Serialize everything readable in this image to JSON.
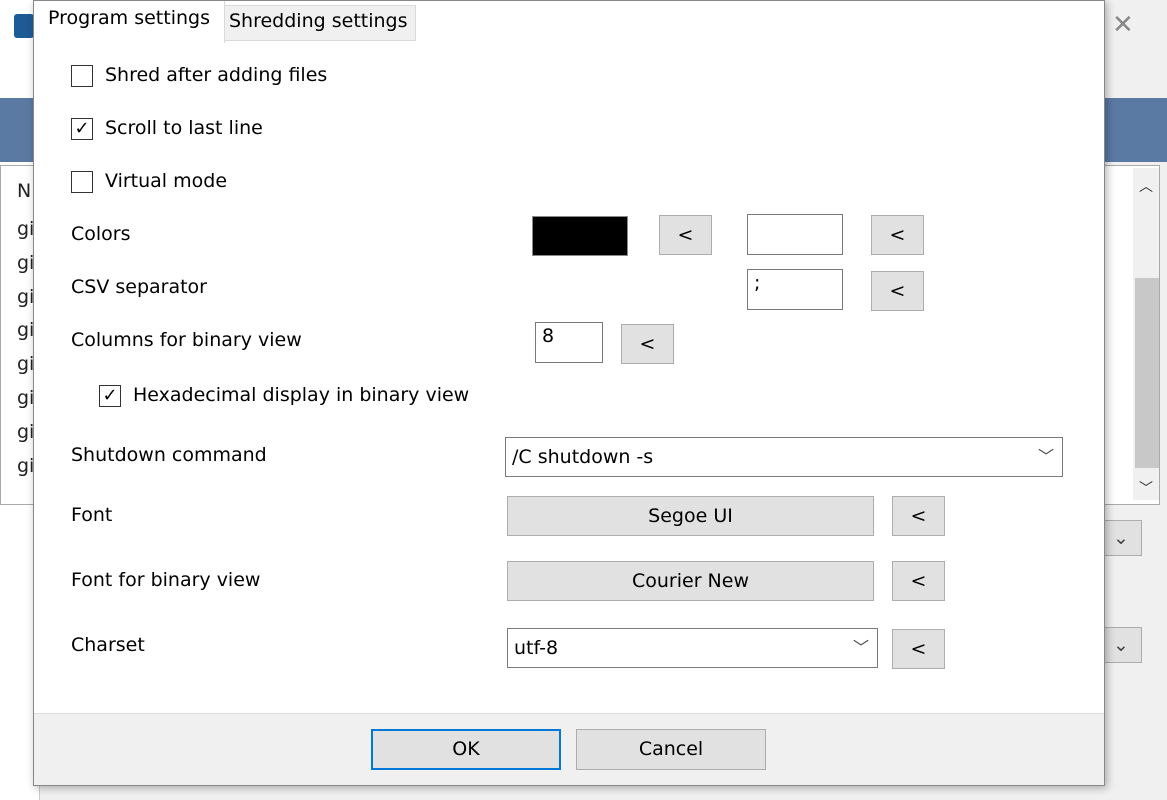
{
  "background_window": {
    "list_header": "N",
    "rows": [
      "gi",
      "gi",
      "gi",
      "gi",
      "gi",
      "gi",
      "gi",
      "gi"
    ],
    "close_icon": "close-icon"
  },
  "tabs": [
    {
      "label": "Program settings",
      "active": true
    },
    {
      "label": "Shredding settings",
      "active": false
    }
  ],
  "options": {
    "shred_after_adding": {
      "label": "Shred after adding files",
      "checked": false
    },
    "scroll_last_line": {
      "label": "Scroll to last line",
      "checked": true
    },
    "virtual_mode": {
      "label": "Virtual mode",
      "checked": false
    },
    "hex_display": {
      "label": "Hexadecimal display in binary view",
      "checked": true
    }
  },
  "colors": {
    "label": "Colors",
    "foreground": "#000000",
    "background": "#ffffff",
    "reset": "<"
  },
  "csv": {
    "label": "CSV separator",
    "value": ";",
    "reset": "<"
  },
  "binary_columns": {
    "label": "Columns for binary view",
    "value": "8",
    "reset": "<"
  },
  "shutdown": {
    "label": "Shutdown command",
    "value": "/C shutdown -s"
  },
  "font": {
    "label": "Font",
    "value": "Segoe UI",
    "reset": "<"
  },
  "binary_font": {
    "label": "Font for binary view",
    "value": "Courier New",
    "reset": "<"
  },
  "charset": {
    "label": "Charset",
    "value": "utf-8",
    "reset": "<"
  },
  "buttons": {
    "ok": "OK",
    "cancel": "Cancel"
  }
}
